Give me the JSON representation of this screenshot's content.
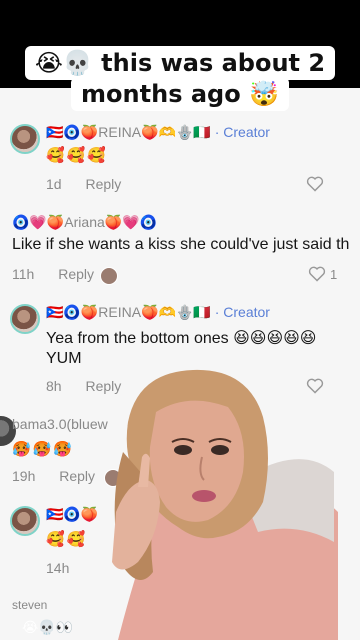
{
  "caption": {
    "line1": "😭💀 this was about 2",
    "line2": "months ago 🤯"
  },
  "comments": [
    {
      "name": "🇵🇷🧿🍑REINA🍑🫶🪬🇮🇹",
      "creator_badge": "· Creator",
      "text": "🥰🥰🥰",
      "time": "1d",
      "reply_label": "Reply"
    },
    {
      "name": "🧿💗🍑Ariana🍑💗🧿",
      "text": "Like if she wants a kiss she could've just said th",
      "time": "11h",
      "reply_label": "Reply",
      "likes": "1"
    },
    {
      "name": "🇵🇷🧿🍑REINA🍑🫶🪬🇮🇹",
      "creator_badge": "· Creator",
      "text": "Yea from the bottom ones 😆😆😆😆😆",
      "text2": "YUM",
      "time": "8h",
      "reply_label": "Reply"
    },
    {
      "name": "bama3.0(bluew",
      "text": "🥵🥵🥵",
      "time": "19h",
      "reply_label": "Reply"
    },
    {
      "name": "🇵🇷🧿🍑",
      "text": "🥰🥰",
      "time": "14h",
      "reply_label": ""
    },
    {
      "name": "steven"
    }
  ],
  "bottom": {
    "text": "😭💀👀"
  }
}
